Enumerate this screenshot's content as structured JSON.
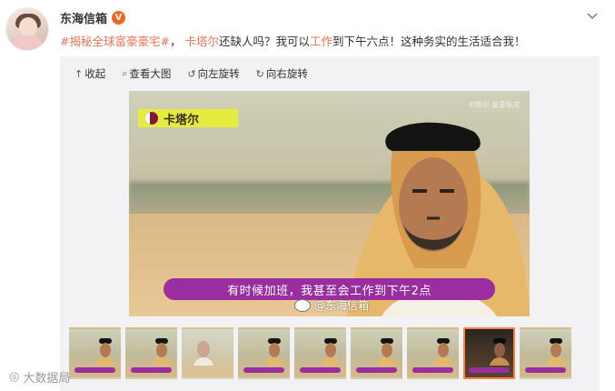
{
  "post": {
    "username": "东海信箱",
    "verified_badge": "V",
    "text_topic": "#揭秘全球富豪豪宅#",
    "text_sep": "，",
    "text_mention": "卡塔尔",
    "text_mid1": "还缺人吗？我可以",
    "text_link": "工作",
    "text_end": "到下午六点！这种务实的生活适合我！",
    "more_icon": "chevron-down-icon"
  },
  "media": {
    "toolbar": {
      "collapse": "收起",
      "view_large": "查看大图",
      "rotate_left": "向左旋转",
      "rotate_right": "向右旋转"
    },
    "image": {
      "country_label": "卡塔尔",
      "top_watermark": "卡塔尔·富豪私宅",
      "subtitle": "有时候加班，我甚至会工作到下午2点",
      "watermark": "@东海信箱"
    },
    "thumbnails": {
      "count": 9,
      "active_index": 7
    }
  },
  "footer_watermark": "大数据局",
  "colors": {
    "accent": "#eb7350",
    "badge": "#f2661f",
    "subtitle_bg": "#9a2d9f",
    "label_bg": "#e5ec3e",
    "active_border": "#ff8140"
  }
}
